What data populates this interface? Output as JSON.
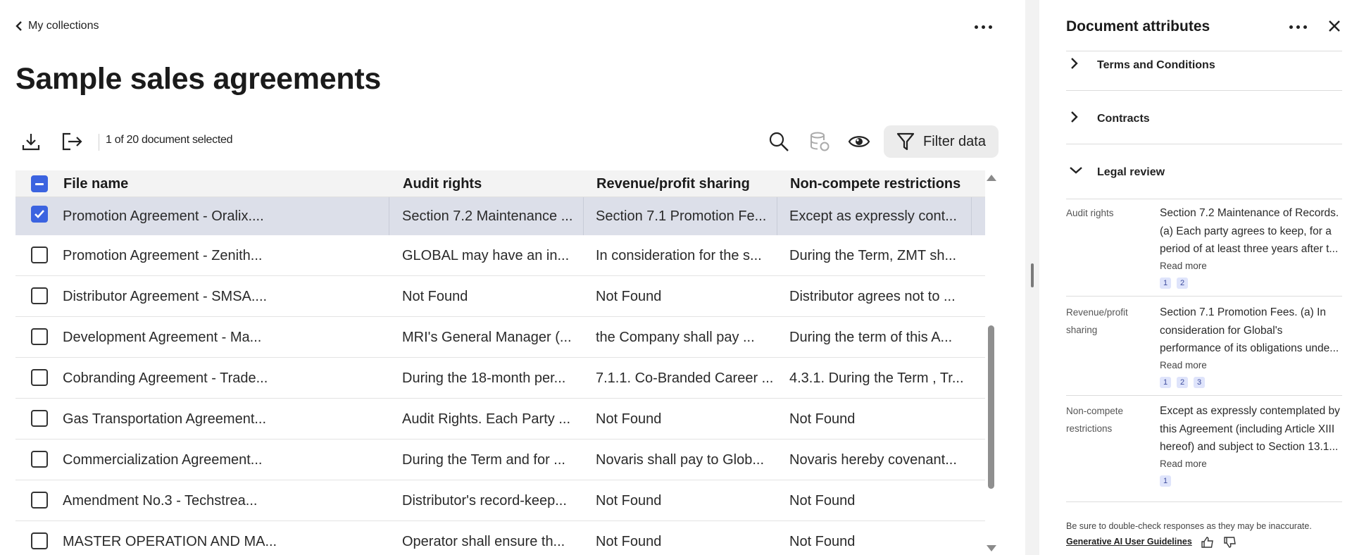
{
  "nav": {
    "back_label": "My collections"
  },
  "page": {
    "title": "Sample sales agreements"
  },
  "toolbar": {
    "selected_text": "1 of 20 document selected",
    "filter_label": "Filter data"
  },
  "table": {
    "columns": [
      "File name",
      "Audit rights",
      "Revenue/profit sharing",
      "Non-compete restrictions"
    ],
    "rows": [
      {
        "checked": true,
        "cells": [
          "Promotion Agreement - Oralix....",
          "Section 7.2 Maintenance ...",
          "Section 7.1 Promotion Fe...",
          "Except as expressly cont..."
        ]
      },
      {
        "checked": false,
        "cells": [
          "Promotion Agreement - Zenith...",
          "GLOBAL may have an in...",
          "In consideration for the s...",
          "During the Term, ZMT sh..."
        ]
      },
      {
        "checked": false,
        "cells": [
          "Distributor Agreement - SMSA....",
          "Not Found",
          "Not Found",
          "Distributor agrees not to ..."
        ]
      },
      {
        "checked": false,
        "cells": [
          "Development Agreement - Ma...",
          "MRI's General Manager (...",
          "the Company shall pay ...",
          "During the term of this A..."
        ]
      },
      {
        "checked": false,
        "cells": [
          "Cobranding Agreement - Trade...",
          "During the 18-month per...",
          "7.1.1. Co-Branded Career ...",
          "4.3.1. During the Term , Tr..."
        ]
      },
      {
        "checked": false,
        "cells": [
          "Gas Transportation Agreement...",
          "Audit Rights. Each Party ...",
          "Not Found",
          "Not Found"
        ]
      },
      {
        "checked": false,
        "cells": [
          "Commercialization Agreement...",
          "During the Term and for ...",
          "Novaris shall pay to Glob...",
          "Novaris hereby covenant..."
        ]
      },
      {
        "checked": false,
        "cells": [
          "Amendment No.3 - Techstrea...",
          "Distributor's record-keep...",
          "Not Found",
          "Not Found"
        ]
      },
      {
        "checked": false,
        "cells": [
          "MASTER OPERATION AND MA...",
          "Operator shall ensure th...",
          "Not Found",
          "Not Found"
        ]
      }
    ]
  },
  "side": {
    "title": "Document attributes",
    "sections": [
      "Terms and Conditions",
      "Contracts",
      "Legal review"
    ],
    "attributes": [
      {
        "label": "Audit rights",
        "lines": [
          "Section 7.2 Maintenance of Records.",
          "(a) Each party agrees to keep, for a",
          "period of at least three years after t..."
        ],
        "more": "Read more",
        "refs": [
          "1",
          "2"
        ]
      },
      {
        "label": "Revenue/profit sharing",
        "lines": [
          "Section 7.1 Promotion Fees. (a) In",
          "consideration for Global's",
          "performance of its obligations unde..."
        ],
        "more": "Read more",
        "refs": [
          "1",
          "2",
          "3"
        ]
      },
      {
        "label": "Non-compete restrictions",
        "lines": [
          "Except as expressly contemplated by",
          "this Agreement (including Article XIII",
          "hereof) and subject to Section 13.1..."
        ],
        "more": "Read more",
        "refs": [
          "1"
        ]
      }
    ],
    "disclaimer": "Be sure to double-check responses as they may be inaccurate.",
    "guidelines_link": "Generative AI User Guidelines"
  },
  "colors": {
    "accent": "#3b63e0",
    "selected_row": "#dcdfe9",
    "chip_bg": "#dfe4fb"
  }
}
